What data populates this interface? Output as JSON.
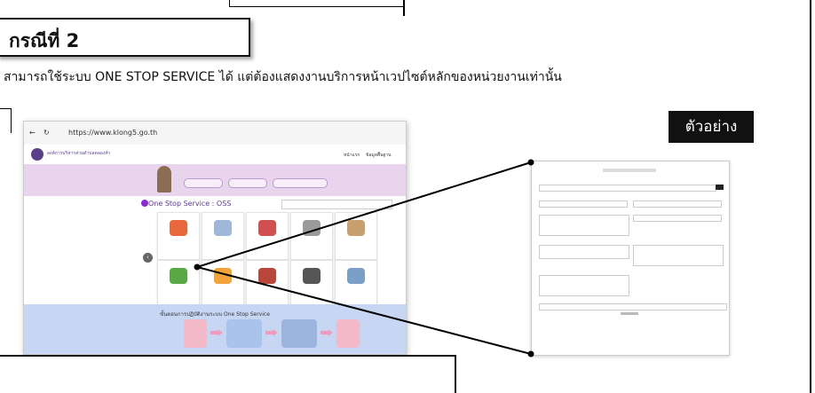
{
  "title": "กรณีที่ 2",
  "description": "สามารถใช้ระบบ ONE STOP SERVICE ได้ แต่ต้องแสดงงานบริการหน้าเวปไซต์หลักของหน่วยงานเท่านั้น",
  "example_label": "ตัวอย่าง",
  "browser": {
    "url": "https://www.klong5.go.th",
    "site_name": "องค์การบริหารส่วนตำบลคลองห้า",
    "nav": [
      "หน้าแรก",
      "ข้อมูลพื้นฐาน"
    ],
    "oss_title": "One Stop Service : OSS",
    "steps_title": "ขั้นตอนการปฏิบัติงานระบบ One Stop Service"
  },
  "colors": {
    "hero": "#e9d4ee",
    "steps_bg": "#c7d7f3",
    "accent": "#5b3a9b"
  }
}
